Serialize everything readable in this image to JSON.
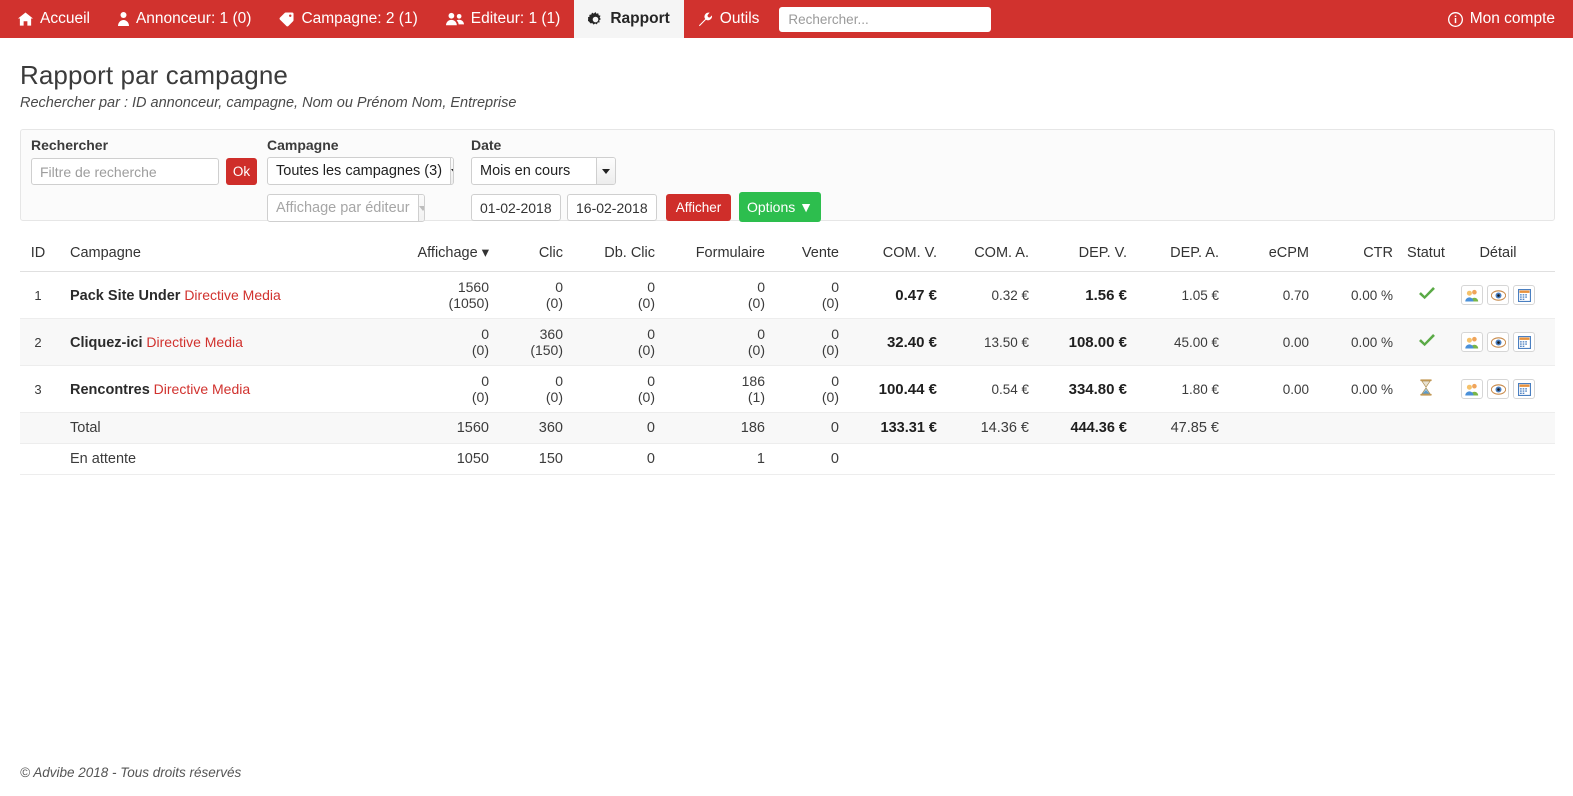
{
  "navbar": {
    "brand_color": "#d1322e",
    "items": [
      {
        "label": "Accueil",
        "icon": "home-icon",
        "active": false
      },
      {
        "label": "Annonceur: 1 (0)",
        "icon": "user-icon",
        "active": false
      },
      {
        "label": "Campagne: 2 (1)",
        "icon": "tag-icon",
        "active": false
      },
      {
        "label": "Editeur: 1 (1)",
        "icon": "users-icon",
        "active": false
      },
      {
        "label": "Rapport",
        "icon": "gear-icon",
        "active": true
      },
      {
        "label": "Outils",
        "icon": "wrench-icon",
        "active": false
      }
    ],
    "search": {
      "value": "",
      "placeholder": "Rechercher..."
    },
    "account": {
      "label": "Mon compte",
      "icon": "info-circle-icon"
    }
  },
  "page": {
    "title": "Rapport par campagne",
    "subtitle": "Rechercher par : ID annonceur, campagne, Nom ou Prénom Nom, Entreprise"
  },
  "filters": {
    "search_label": "Rechercher",
    "search_input": {
      "value": "",
      "placeholder": "Filtre de recherche"
    },
    "ok_button": "Ok",
    "campaign_label": "Campagne",
    "campaign_select": {
      "selected": "Toutes les campagnes (3)",
      "disabled": false
    },
    "editor_select": {
      "selected": "Affichage par éditeur",
      "disabled": true
    },
    "date_label": "Date",
    "date_range_select": {
      "selected": "Mois en cours",
      "disabled": false
    },
    "date_from": "01-02-2018",
    "date_to": "16-02-2018",
    "show_button": "Afficher",
    "options_button": "Options ▼",
    "show_button_color": "#cf2e2a",
    "options_button_color": "#2dbe4e"
  },
  "chart_data": {
    "type": "table",
    "title": "Rapport par campagne",
    "sort_column": "Affichage",
    "sort_direction": "desc",
    "columns": [
      "ID",
      "Campagne",
      "Affichage ▾",
      "Clic",
      "Db. Clic",
      "Formulaire",
      "Vente",
      "COM. V.",
      "COM. A.",
      "DEP. V.",
      "DEP. A.",
      "eCPM",
      "CTR",
      "Statut",
      "Détail"
    ],
    "rows": [
      {
        "id": "1",
        "campaign": "Pack Site Under",
        "advertiser": "Directive Media",
        "affichage": "1560",
        "affichage_pending": "(1050)",
        "clic": "0",
        "clic_pending": "(0)",
        "db_clic": "0",
        "db_clic_pending": "(0)",
        "formulaire": "0",
        "formulaire_pending": "(0)",
        "vente": "0",
        "vente_pending": "(0)",
        "com_v": "0.47 €",
        "com_a": "0.32 €",
        "dep_v": "1.56 €",
        "dep_a": "1.05 €",
        "ecpm": "0.70",
        "ctr": "0.00 %",
        "statut": "valid",
        "statut_icon": "green-check-icon"
      },
      {
        "id": "2",
        "campaign": "Cliquez-ici",
        "advertiser": "Directive Media",
        "affichage": "0",
        "affichage_pending": "(0)",
        "clic": "360",
        "clic_pending": "(150)",
        "db_clic": "0",
        "db_clic_pending": "(0)",
        "formulaire": "0",
        "formulaire_pending": "(0)",
        "vente": "0",
        "vente_pending": "(0)",
        "com_v": "32.40 €",
        "com_a": "13.50 €",
        "dep_v": "108.00 €",
        "dep_a": "45.00 €",
        "ecpm": "0.00",
        "ctr": "0.00 %",
        "statut": "valid",
        "statut_icon": "green-check-icon"
      },
      {
        "id": "3",
        "campaign": "Rencontres",
        "advertiser": "Directive Media",
        "affichage": "0",
        "affichage_pending": "(0)",
        "clic": "0",
        "clic_pending": "(0)",
        "db_clic": "0",
        "db_clic_pending": "(0)",
        "formulaire": "186",
        "formulaire_pending": "(1)",
        "vente": "0",
        "vente_pending": "(0)",
        "com_v": "100.44 €",
        "com_a": "0.54 €",
        "dep_v": "334.80 €",
        "dep_a": "1.80 €",
        "ecpm": "0.00",
        "ctr": "0.00 %",
        "statut": "pending",
        "statut_icon": "hourglass-icon"
      }
    ],
    "total_row": {
      "label": "Total",
      "affichage": "1560",
      "clic": "360",
      "db_clic": "0",
      "formulaire": "186",
      "vente": "0",
      "com_v": "133.31 €",
      "com_a": "14.36 €",
      "dep_v": "444.36 €",
      "dep_a": "47.85 €",
      "ecpm": "",
      "ctr": ""
    },
    "pending_row": {
      "label": "En attente",
      "affichage": "1050",
      "clic": "150",
      "db_clic": "0",
      "formulaire": "1",
      "vente": "0",
      "com_v": "",
      "com_a": "",
      "dep_v": "",
      "dep_a": "",
      "ecpm": "",
      "ctr": ""
    },
    "detail_icons": [
      "users-detail-icon",
      "eye-detail-icon",
      "calendar-detail-icon"
    ]
  },
  "footer": {
    "text": "© Advibe 2018 - Tous droits réservés"
  }
}
